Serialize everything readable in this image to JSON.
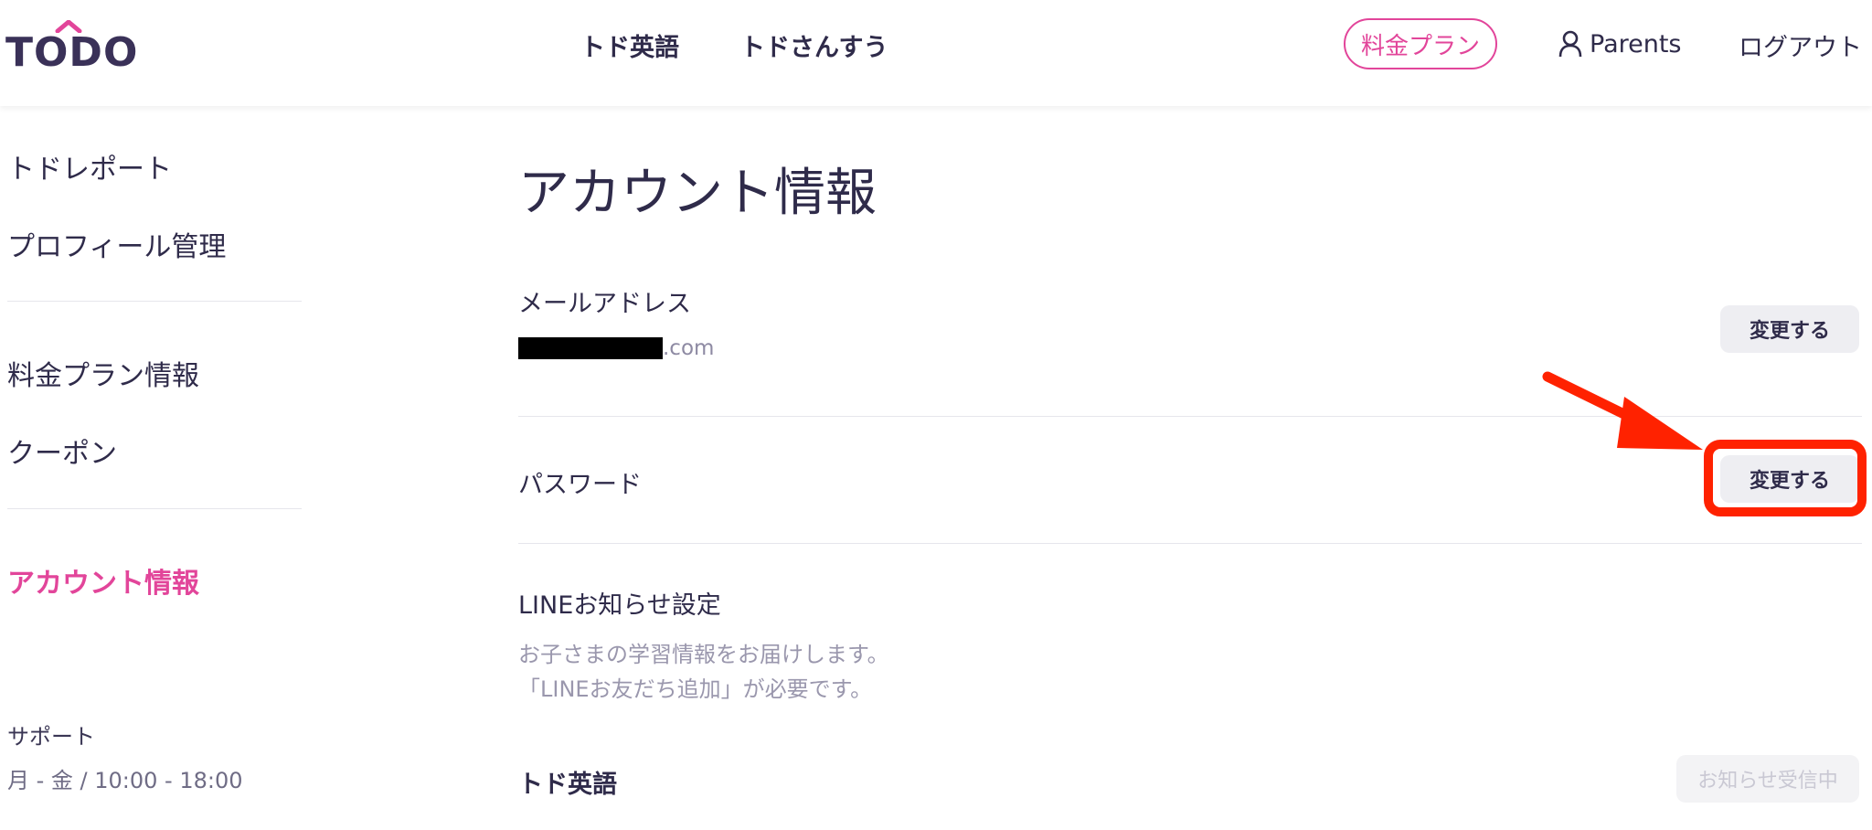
{
  "header": {
    "logo": "TODO",
    "nav": [
      "トド英語",
      "トドさんすう"
    ],
    "plan_button": "料金プラン",
    "parents_label": "Parents",
    "logout": "ログアウト"
  },
  "sidebar": {
    "items": [
      {
        "label": "トドレポート"
      },
      {
        "label": "プロフィール管理"
      },
      {
        "label": "料金プラン情報"
      },
      {
        "label": "クーポン"
      },
      {
        "label": "アカウント情報",
        "active": true
      }
    ],
    "support_title": "サポート",
    "support_hours": "月 - 金 / 10:00 - 18:00"
  },
  "main": {
    "title": "アカウント情報",
    "email": {
      "label": "メールアドレス",
      "value_suffix": ".com",
      "button": "変更する"
    },
    "password": {
      "label": "パスワード",
      "button": "変更する"
    },
    "line": {
      "label": "LINEお知らせ設定",
      "desc_line1": "お子さまの学習情報をお届けします。",
      "desc_line2": "「LINEお友だち追加」が必要です。"
    },
    "todo_english": {
      "label": "トド英語",
      "button": "お知らせ受信中"
    }
  },
  "colors": {
    "accent": "#e2459a",
    "text": "#2f2b4a",
    "annotation": "#ff2200"
  },
  "icons": {
    "parents": "person-icon"
  }
}
